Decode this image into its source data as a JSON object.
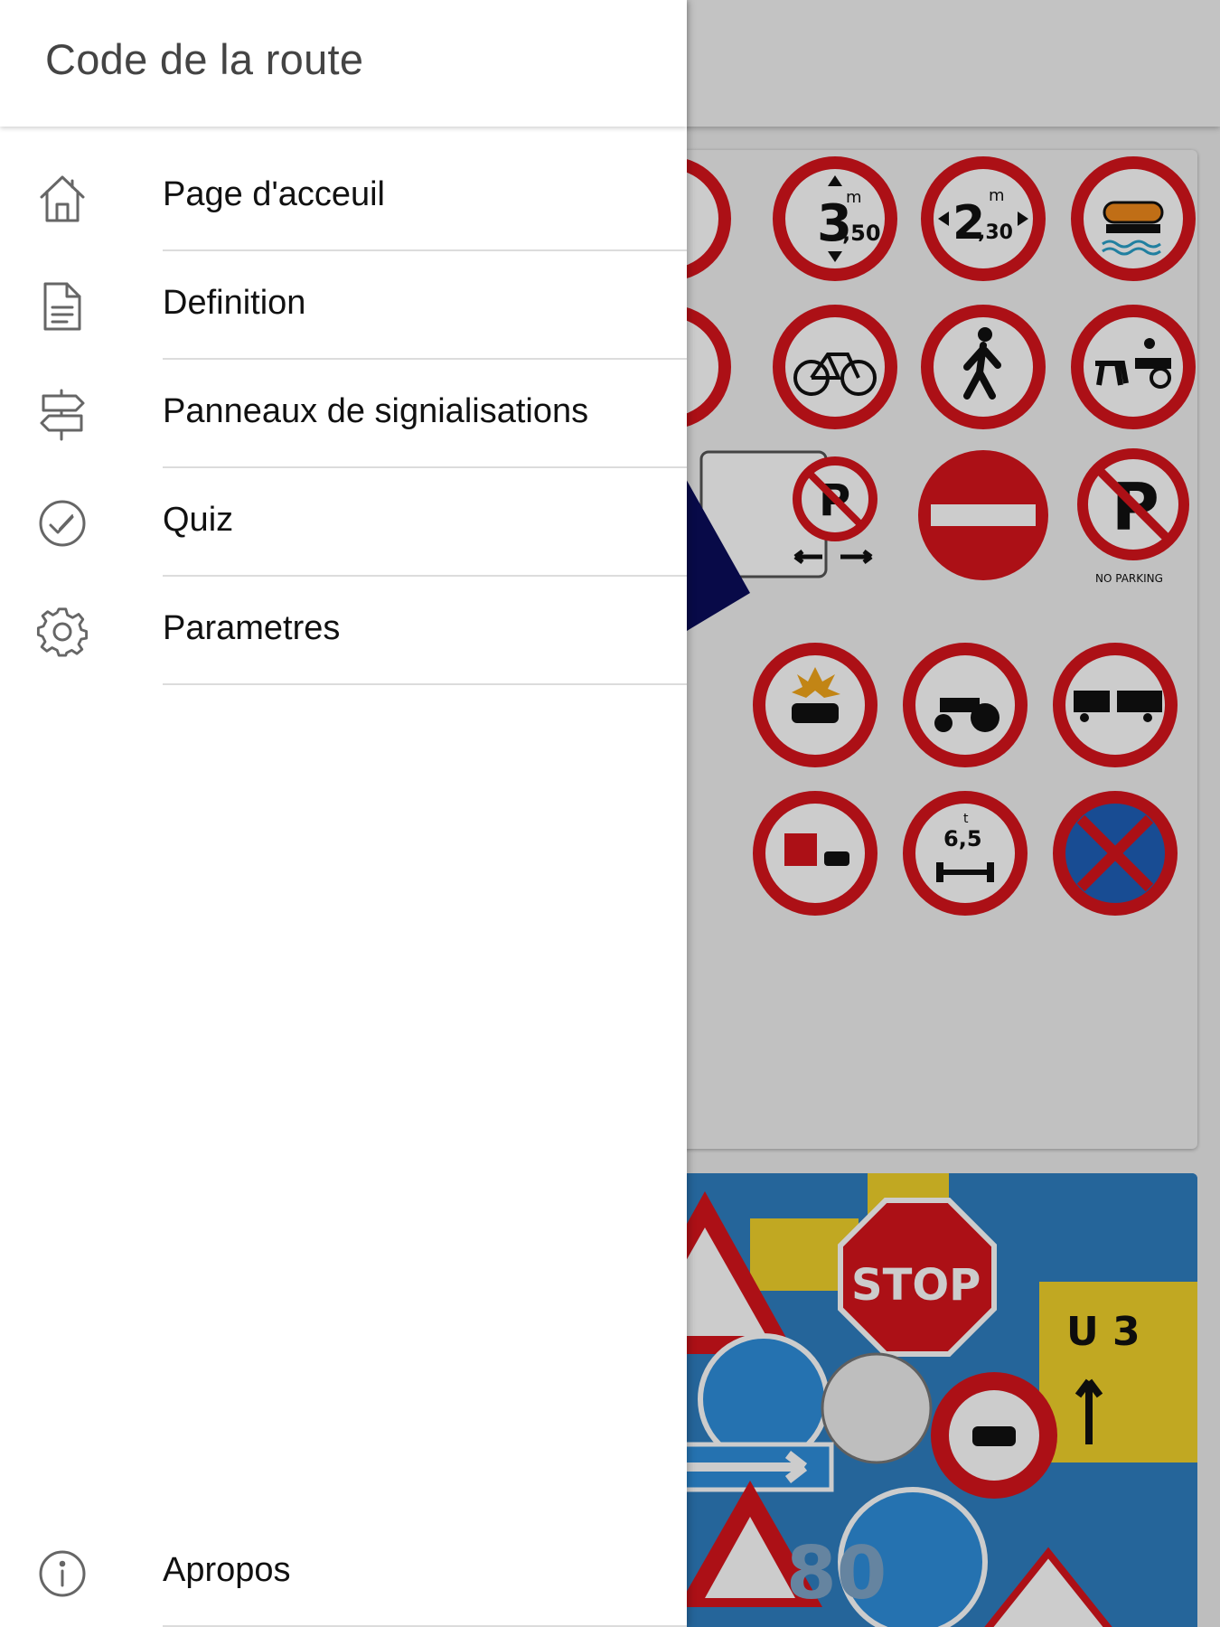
{
  "drawer": {
    "title": "Code de la route",
    "items": [
      {
        "label": "Page d'acceuil",
        "icon": "home-icon"
      },
      {
        "label": "Definition",
        "icon": "document-icon"
      },
      {
        "label": "Panneaux de signialisations",
        "icon": "signpost-icon"
      },
      {
        "label": "Quiz",
        "icon": "check-circle-icon"
      },
      {
        "label": "Parametres",
        "icon": "gear-icon"
      }
    ],
    "footer_item": {
      "label": "Apropos",
      "icon": "info-icon"
    }
  },
  "background": {
    "sign_texts": {
      "height_limit": "3",
      "height_limit_decimal": ",50",
      "height_limit_unit": "m",
      "width_limit": "2",
      "width_limit_decimal": ",30",
      "width_limit_unit": "m",
      "no_parking_caption": "NO PARKING",
      "axle_weight": "6,5",
      "axle_weight_unit": "t",
      "stop": "STOP",
      "u3": "U 3",
      "speed": "80"
    }
  },
  "colors": {
    "sign_red": "#d8141c",
    "sign_blue": "#1f5fb8",
    "icon_gray": "#666666",
    "divider": "#dcdcdc"
  }
}
